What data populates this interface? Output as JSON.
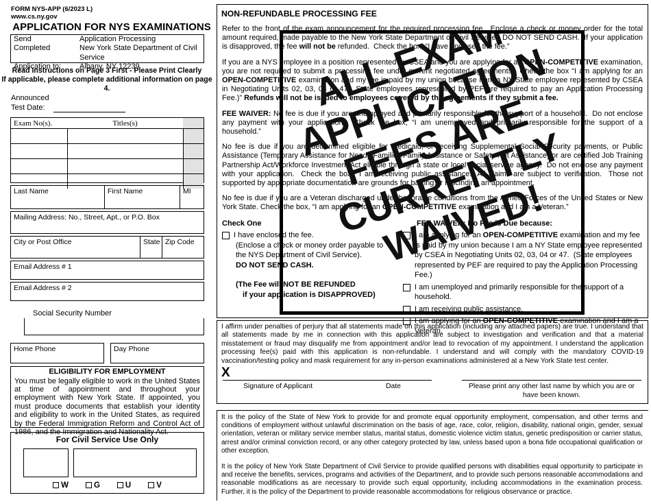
{
  "left": {
    "form_code": "FORM NYS-APP (6/2023 L)",
    "website": "www.cs.ny.gov",
    "app_title": "APPLICATION FOR NYS EXAMINATIONS",
    "send_to": {
      "line1_label": "Send",
      "line1_value": "Application Processing",
      "line2_label": "Completed",
      "line2_value": "New York State Department of Civil Service",
      "line3_label": "Application to:",
      "line3_value": "Albany, NY 12239"
    },
    "instructions_line1": "Read Instructions on Page 3 First - Please Print Clearly",
    "instructions_line2": "If applicable, please complete additional information on page 4.",
    "announced_line1": "Announced",
    "announced_line2": "Test Date:",
    "exam_table": {
      "col_exam": "Exam No(s).",
      "col_titles": "Titles(s)",
      "row_count": 4
    },
    "name_fields": {
      "last": "Last Name",
      "first": "First Name",
      "mi": "MI"
    },
    "mailing_address": "Mailing Address:  No., Street, Apt., or P.O. Box",
    "city_fields": {
      "city": "City or Post Office",
      "state": "State",
      "zip": "Zip Code"
    },
    "email1": "Email Address # 1",
    "email2": "Email Address # 2",
    "ssn": "Social Security Number",
    "home_phone": "Home Phone",
    "day_phone": "Day Phone",
    "eligibility": {
      "title": "ELIGIBILITY FOR EMPLOYMENT",
      "body": "You must be legally eligible to work in the United States at time of appointment and throughout your employment with New York State.  If appointed, you must produce documents that establish your identity and eligibility to work in the United States, as required by the Federal Immigration Reform and Control Act of 1986, and the Immigration and Nationality Act."
    },
    "civil_service": {
      "title": "For Civil Service Use Only",
      "checks": [
        "W",
        "G",
        "U",
        "V"
      ]
    }
  },
  "right": {
    "header": "NON-REFUNDABLE PROCESSING FEE",
    "paragraphs": [
      "Refer to the front of the exam announcement for the required processing fee.  Enclose a check or money order for the total amount required, made payable to the New York State Department of Civil Service.  DO NOT SEND CASH.  If your application is disapproved, the fee will not be refunded.  Check the box, “I have enclosed the fee.”",
      "If you are a NYS employee in a position represented by CSEA and you are applying for an OPEN-COMPETITIVE examination, you are not required to submit a processing fee under current negotiated agreements.  Check the box “I am applying for an OPEN-COMPETITIVE examination and my fee is paid by my union because I am a NY State employee represented by CSEA in Negotiating Units 02, 03, 04 or 47.  State employees represented by PEF are required to pay an Application Processing Fee.)” Refunds will not be issued to employees covered by the agreements if they submit a fee.",
      "FEE WAIVER: No fee is due if you are unemployed and primarily responsible for the support of a household.  Do not enclose any payment with your application.  Check the box, “I am unemployed and primarily responsible for the support of a household.”",
      "No fee is due if you are determined eligible for Medicaid, or receiving Supplemental Social Security payments, or Public Assistance (Temporary Assistance for Needy Families/Family Assistance or Safety Net Assistance) or are certified Job Training Partnership Act/Workforce Investment Act eligible through a state or local social service agency.  Do not enclose any payment with your application.  Check the box, “I am receiving public assistance.” All claims are subject to verification.  Those not supported by appropriate documentation are grounds for barring or rescinding an appointment.",
      "No fee is due if you are a Veteran discharged under honorable conditions from the Armed Forces of the United States or New York State. Check the box, “I am applying for an OPEN-COMPETITIVE examination and I am a Veteran.”"
    ],
    "check_one": {
      "title": "Check One",
      "option1": "I have enclosed the fee.",
      "option1_sub1": "(Enclose a check or money order payable to",
      "option1_sub2": "the NYS Department of Civil Service).",
      "option1_sub3": "DO NOT SEND CASH.",
      "note1": "(The Fee will NOT BE REFUNDED",
      "note2": "if your application is DISAPPROVED)"
    },
    "fee_waiver": {
      "title": "FEE WAIVER:  No Fee is Due because:",
      "options": [
        "I am applying for an OPEN-COMPETITIVE examination and my fee is paid by my union because I am a NY State employee represented by CSEA in Negotiating Units 02, 03, 04 or 47.  (State employees represented by PEF are required to pay the Application Processing Fee.)",
        "I am unemployed and primarily responsible for the support of a household.",
        "I am receiving public assistance.",
        "I am applying for an OPEN-COMPETITIVE examination and I am a Veteran."
      ]
    },
    "affirmation": "I affirm under penalties of perjury that all statements made on this application (including any attached papers) are true.  I understand that all statements made by me in connection with this application are subject to investigation and verification and that a material misstatement or fraud may disqualify me from appointment and/or lead to revocation of my appointment. I understand the application processing fee(s) paid with this application is non-refundable. I understand and will comply with the mandatory COVID-19 vaccination/testing policy and mask requirement for any in-person examinations administered at a New York State test center.",
    "signature_mark": "X",
    "signature_label": "Signature of Applicant",
    "date_label": "Date",
    "other_name_label": "Please print any other last name by which you are or have been known.",
    "policy_paragraphs": [
      "It is the policy of the State of New York to provide for and promote equal opportunity employment, compensation, and other terms and conditions of employment without unlawful discrimination on the basis of age, race, color, religion, disability, national origin, gender, sexual orientation, veteran or military service member status, marital status, domestic violence victim status, genetic predisposition or carrier status, arrest and/or criminal conviction record, or any other category protected by law, unless based upon a bona fide occupational qualification or other exception.",
      "It is the policy of New York State Department of Civil Service to provide qualified persons with disabilities equal opportunity to participate in and receive the benefits, services, programs and activities of the Department, and to provide such persons reasonable accommodations and reasonable modifications as are necessary to provide such equal opportunity, including accommodations in the examination process.  Further, it is the policy of the Department to provide reasonable accommodations for religious observance or practice."
    ]
  },
  "watermark": {
    "text": "ALL EXAM\nAPPLICATION\nFEES ARE\nCURRENTLY\nWAIVED!",
    "color": "#111111",
    "rotation_deg": -19
  }
}
